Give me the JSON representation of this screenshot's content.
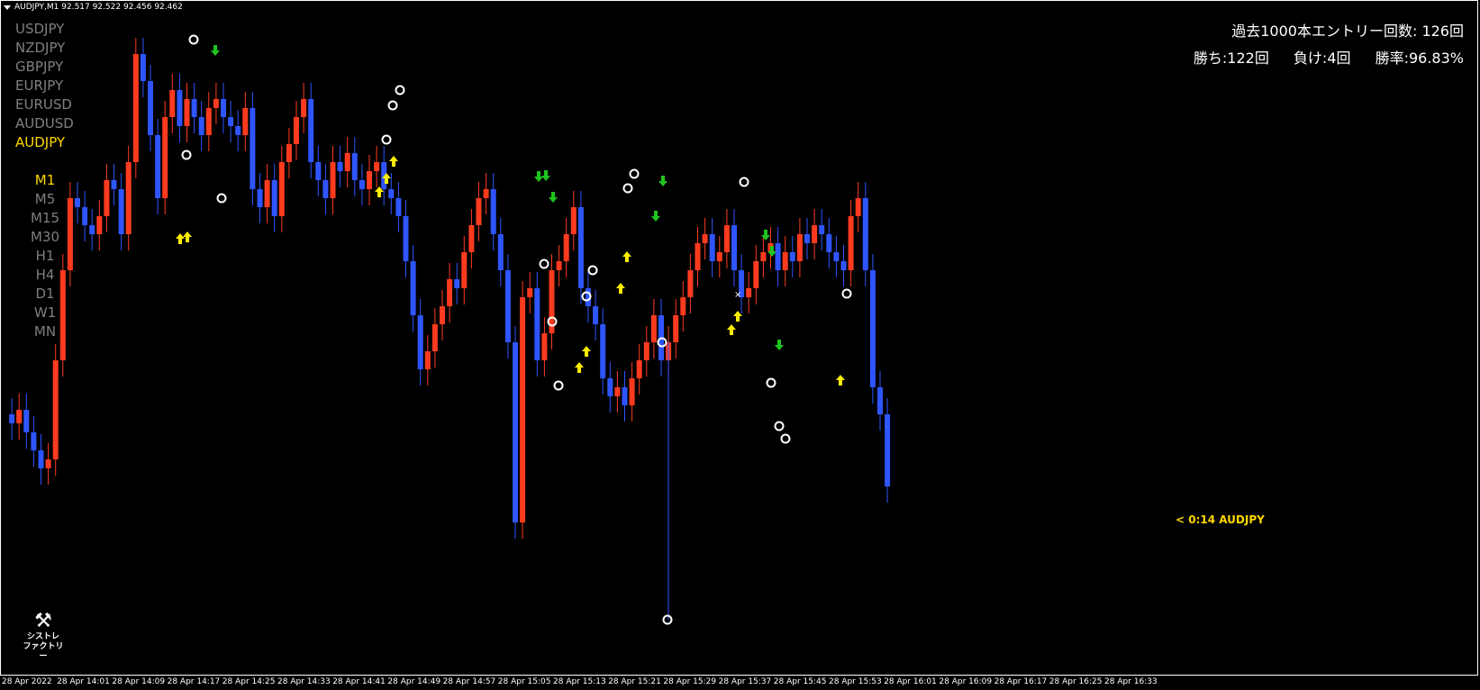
{
  "window": {
    "title": "AUDJPY,M1  92.517 92.522 92.456 92.462"
  },
  "symbols": [
    {
      "label": "USDJPY",
      "active": false
    },
    {
      "label": "NZDJPY",
      "active": false
    },
    {
      "label": "GBPJPY",
      "active": false
    },
    {
      "label": "EURJPY",
      "active": false
    },
    {
      "label": "EURUSD",
      "active": false
    },
    {
      "label": "AUDUSD",
      "active": false
    },
    {
      "label": "AUDJPY",
      "active": true
    }
  ],
  "timeframes": [
    {
      "label": "M1",
      "active": true
    },
    {
      "label": "M5",
      "active": false
    },
    {
      "label": "M15",
      "active": false
    },
    {
      "label": "M30",
      "active": false
    },
    {
      "label": "H1",
      "active": false
    },
    {
      "label": "H4",
      "active": false
    },
    {
      "label": "D1",
      "active": false
    },
    {
      "label": "W1",
      "active": false
    },
    {
      "label": "MN",
      "active": false
    }
  ],
  "stats": {
    "entries": "過去1000本エントリー回数: 126回",
    "wins": "勝ち:122回",
    "losses": "負け:4回",
    "win_rate": "勝率:96.83%"
  },
  "price_label": "< 0:14 AUDJPY",
  "logo": {
    "line1": "シストレ",
    "line2": "ファクトリー",
    "icon": "wrench-screwdriver-icon"
  },
  "time_axis": [
    "28 Apr 2022",
    "28 Apr 14:01",
    "28 Apr 14:09",
    "28 Apr 14:17",
    "28 Apr 14:25",
    "28 Apr 14:33",
    "28 Apr 14:41",
    "28 Apr 14:49",
    "28 Apr 14:57",
    "28 Apr 15:05",
    "28 Apr 15:13",
    "28 Apr 15:21",
    "28 Apr 15:29",
    "28 Apr 15:37",
    "28 Apr 15:45",
    "28 Apr 15:53",
    "28 Apr 16:01",
    "28 Apr 16:09",
    "28 Apr 16:17",
    "28 Apr 16:25",
    "28 Apr 16:33"
  ],
  "colors": {
    "bull": "#ff3b1f",
    "bear": "#2f55ff",
    "up_arrow": "#ffee00",
    "down_arrow": "#1ec41e",
    "circle": "#ffffff",
    "text_active": "#ffd700",
    "text_inactive": "#7f7f7f"
  }
}
